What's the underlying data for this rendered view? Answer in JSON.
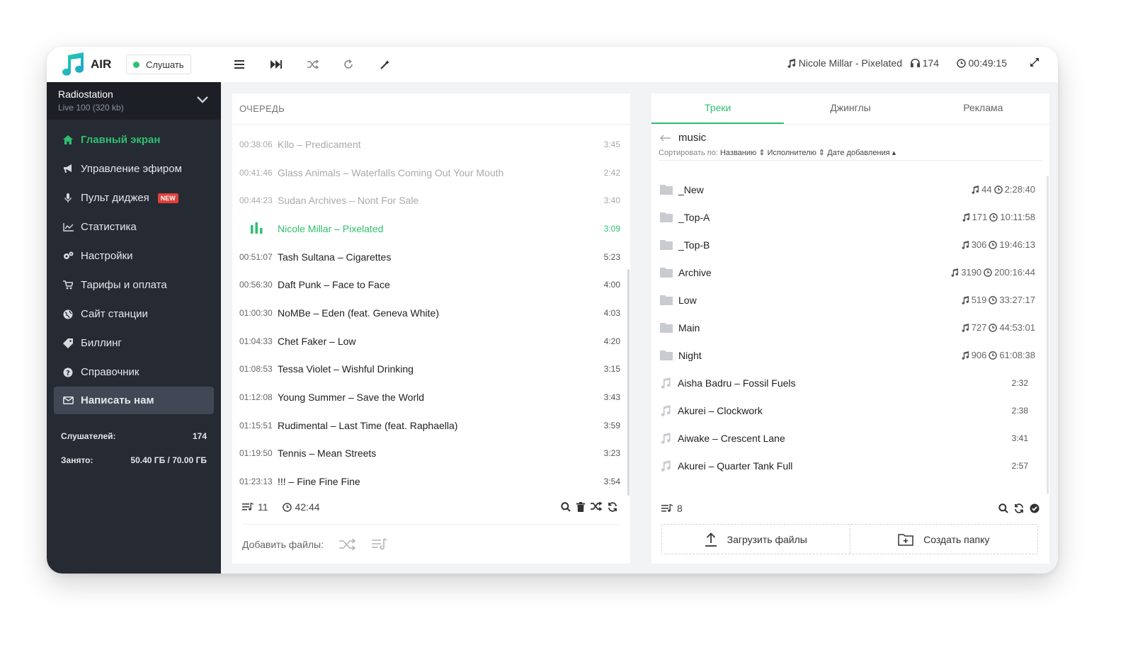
{
  "app": {
    "name": "AIR",
    "listen_label": "Слушать",
    "now_playing": "Nicole Millar - Pixelated",
    "listeners": "174",
    "elapsed": "00:49:15"
  },
  "station": {
    "name": "Radiostation",
    "stream": "Live 100 (320 kb)"
  },
  "nav": [
    {
      "label": "Главный экран",
      "icon": "home-icon"
    },
    {
      "label": "Управление эфиром",
      "icon": "megaphone-icon"
    },
    {
      "label": "Пульт диджея",
      "icon": "microphone-icon",
      "badge": "NEW"
    },
    {
      "label": "Статистика",
      "icon": "chart-icon"
    },
    {
      "label": "Настройки",
      "icon": "gears-icon"
    },
    {
      "label": "Тарифы и оплата",
      "icon": "cart-icon"
    },
    {
      "label": "Сайт станции",
      "icon": "globe-icon"
    },
    {
      "label": "Биллинг",
      "icon": "tag-icon"
    },
    {
      "label": "Справочник",
      "icon": "question-icon"
    },
    {
      "label": "Написать нам",
      "icon": "envelope-icon"
    }
  ],
  "stats": {
    "listeners_label": "Слушателей:",
    "listeners_value": "174",
    "used_label": "Занято:",
    "used_value": "50.40 ГБ / 70.00 ГБ"
  },
  "queue": {
    "title": "ОЧЕРЕДЬ",
    "rows": [
      {
        "time": "00:38:06",
        "title": "Kllo – Predicament",
        "dur": "3:45",
        "state": "played"
      },
      {
        "time": "00:41:46",
        "title": "Glass Animals – Waterfalls Coming Out Your Mouth",
        "dur": "2:42",
        "state": "played"
      },
      {
        "time": "00:44:23",
        "title": "Sudan Archives – Nont For Sale",
        "dur": "3:40",
        "state": "played"
      },
      {
        "time": "",
        "title": "Nicole Millar – Pixelated",
        "dur": "3:09",
        "state": "current"
      },
      {
        "time": "00:51:07",
        "title": "Tash Sultana – Cigarettes",
        "dur": "5:23",
        "state": "queued"
      },
      {
        "time": "00:56:30",
        "title": "Daft Punk – Face to Face",
        "dur": "4:00",
        "state": "queued"
      },
      {
        "time": "01:00:30",
        "title": "NoMBe – Eden (feat. Geneva White)",
        "dur": "4:03",
        "state": "queued"
      },
      {
        "time": "01:04:33",
        "title": "Chet Faker – Low",
        "dur": "4:20",
        "state": "queued"
      },
      {
        "time": "01:08:53",
        "title": "Tessa Violet – Wishful Drinking",
        "dur": "3:15",
        "state": "queued"
      },
      {
        "time": "01:12:08",
        "title": "Young Summer – Save the World",
        "dur": "3:43",
        "state": "queued"
      },
      {
        "time": "01:15:51",
        "title": "Rudimental – Last Time (feat. Raphaella)",
        "dur": "3:59",
        "state": "queued"
      },
      {
        "time": "01:19:50",
        "title": "Tennis – Mean Streets",
        "dur": "3:23",
        "state": "queued"
      },
      {
        "time": "01:23:13",
        "title": "!!! – Fine Fine Fine",
        "dur": "3:54",
        "state": "queued"
      }
    ],
    "count": "11",
    "total": "42:44",
    "add_label": "Добавить файлы:"
  },
  "library": {
    "tabs": [
      "Треки",
      "Джинглы",
      "Реклама"
    ],
    "path": "music",
    "sort_label": "Сортировать по:",
    "sort_options": [
      "Названию",
      "Исполнителю",
      "Дате добавления"
    ],
    "folders": [
      {
        "name": "_New",
        "tracks": "44",
        "duration": "2:28:40"
      },
      {
        "name": "_Top-A",
        "tracks": "171",
        "duration": "10:11:58"
      },
      {
        "name": "_Top-B",
        "tracks": "306",
        "duration": "19:46:13"
      },
      {
        "name": "Archive",
        "tracks": "3190",
        "duration": "200:16:44"
      },
      {
        "name": "Low",
        "tracks": "519",
        "duration": "33:27:17"
      },
      {
        "name": "Main",
        "tracks": "727",
        "duration": "44:53:01"
      },
      {
        "name": "Night",
        "tracks": "906",
        "duration": "61:08:38"
      }
    ],
    "tracks": [
      {
        "title": "Aisha Badru – Fossil Fuels",
        "dur": "2:32"
      },
      {
        "title": "Akurei – Clockwork",
        "dur": "2:38"
      },
      {
        "title": "Aiwake – Crescent Lane",
        "dur": "3:41"
      },
      {
        "title": "Akurei – Quarter Tank Full",
        "dur": "2:57"
      }
    ],
    "count": "8",
    "upload_label": "Загрузить файлы",
    "folder_label": "Создать папку"
  },
  "colors": {
    "accent": "#2fbf71",
    "sidebar": "#262a33",
    "badge": "#e0403a"
  }
}
